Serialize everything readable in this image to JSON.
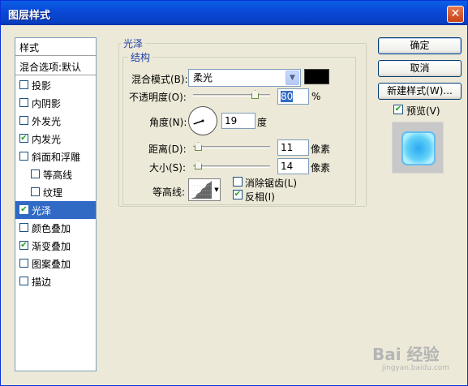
{
  "window": {
    "title": "图层样式",
    "close_glyph": "✕"
  },
  "left_panel": {
    "header": "样式",
    "blend_default": "混合选项:默认",
    "items": [
      {
        "label": "投影",
        "checked": false
      },
      {
        "label": "内阴影",
        "checked": false
      },
      {
        "label": "外发光",
        "checked": false
      },
      {
        "label": "内发光",
        "checked": true
      },
      {
        "label": "斜面和浮雕",
        "checked": false
      },
      {
        "label": "等高线",
        "checked": false
      },
      {
        "label": "纹理",
        "checked": false
      },
      {
        "label": "光泽",
        "checked": true,
        "selected": true
      },
      {
        "label": "颜色叠加",
        "checked": false
      },
      {
        "label": "渐变叠加",
        "checked": true
      },
      {
        "label": "图案叠加",
        "checked": false
      },
      {
        "label": "描边",
        "checked": false
      }
    ]
  },
  "satin": {
    "group_title": "光泽",
    "struct_title": "结构",
    "blend_mode_label": "混合模式(B):",
    "blend_mode_value": "柔光",
    "opacity_label": "不透明度(O):",
    "opacity_value": "80",
    "opacity_unit": "%",
    "angle_label": "角度(N):",
    "angle_value": "19",
    "angle_unit": "度",
    "distance_label": "距离(D):",
    "distance_value": "11",
    "distance_unit": "像素",
    "size_label": "大小(S):",
    "size_value": "14",
    "size_unit": "像素",
    "contour_label": "等高线:",
    "antialias_label": "消除锯齿(L)",
    "antialias_checked": false,
    "invert_label": "反相(I)",
    "invert_checked": true
  },
  "buttons": {
    "ok": "确定",
    "cancel": "取消",
    "new_style": "新建样式(W)..."
  },
  "preview": {
    "label": "预览(V)",
    "checked": true
  },
  "watermark": {
    "text": "Bai 经验",
    "sub": "jingyan.baidu.com"
  },
  "colors": {
    "title_bar": "#0a4ad8",
    "selected_item": "#316ac5",
    "group_title": "#1c3ea8",
    "satin_color": "#000000"
  }
}
